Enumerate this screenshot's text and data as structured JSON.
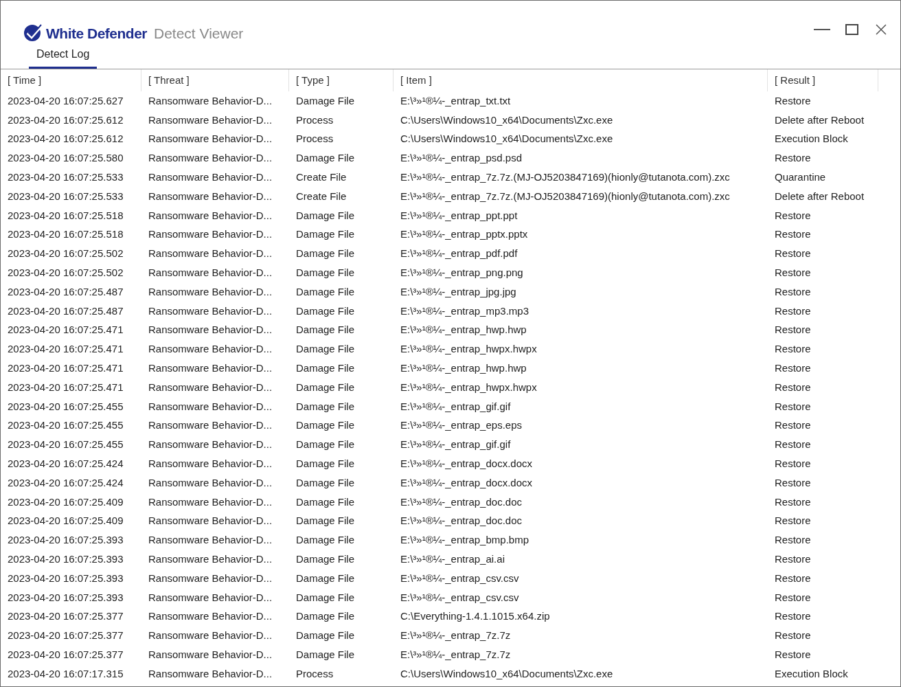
{
  "window": {
    "brand": "White Defender",
    "title": "Detect Viewer"
  },
  "tabs": [
    {
      "label": "Detect Log",
      "selected": true
    }
  ],
  "table": {
    "columns": [
      "[ Time ]",
      "[ Threat ]",
      "[ Type ]",
      "[ Item ]",
      "[ Result ]"
    ],
    "rows": [
      [
        "2023-04-20 16:07:25.627",
        "Ransomware Behavior-D...",
        "Damage File",
        "E:\\³»¹®¼-_entrap_txt.txt",
        "Restore"
      ],
      [
        "2023-04-20 16:07:25.612",
        "Ransomware Behavior-D...",
        "Process",
        "C:\\Users\\Windows10_x64\\Documents\\Zxc.exe",
        "Delete after Reboot"
      ],
      [
        "2023-04-20 16:07:25.612",
        "Ransomware Behavior-D...",
        "Process",
        "C:\\Users\\Windows10_x64\\Documents\\Zxc.exe",
        "Execution Block"
      ],
      [
        "2023-04-20 16:07:25.580",
        "Ransomware Behavior-D...",
        "Damage File",
        "E:\\³»¹®¼-_entrap_psd.psd",
        "Restore"
      ],
      [
        "2023-04-20 16:07:25.533",
        "Ransomware Behavior-D...",
        "Create File",
        "E:\\³»¹®¼-_entrap_7z.7z.(MJ-OJ5203847169)(hionly@tutanota.com).zxc",
        "Quarantine"
      ],
      [
        "2023-04-20 16:07:25.533",
        "Ransomware Behavior-D...",
        "Create File",
        "E:\\³»¹®¼-_entrap_7z.7z.(MJ-OJ5203847169)(hionly@tutanota.com).zxc",
        "Delete after Reboot"
      ],
      [
        "2023-04-20 16:07:25.518",
        "Ransomware Behavior-D...",
        "Damage File",
        "E:\\³»¹®¼-_entrap_ppt.ppt",
        "Restore"
      ],
      [
        "2023-04-20 16:07:25.518",
        "Ransomware Behavior-D...",
        "Damage File",
        "E:\\³»¹®¼-_entrap_pptx.pptx",
        "Restore"
      ],
      [
        "2023-04-20 16:07:25.502",
        "Ransomware Behavior-D...",
        "Damage File",
        "E:\\³»¹®¼-_entrap_pdf.pdf",
        "Restore"
      ],
      [
        "2023-04-20 16:07:25.502",
        "Ransomware Behavior-D...",
        "Damage File",
        "E:\\³»¹®¼-_entrap_png.png",
        "Restore"
      ],
      [
        "2023-04-20 16:07:25.487",
        "Ransomware Behavior-D...",
        "Damage File",
        "E:\\³»¹®¼-_entrap_jpg.jpg",
        "Restore"
      ],
      [
        "2023-04-20 16:07:25.487",
        "Ransomware Behavior-D...",
        "Damage File",
        "E:\\³»¹®¼-_entrap_mp3.mp3",
        "Restore"
      ],
      [
        "2023-04-20 16:07:25.471",
        "Ransomware Behavior-D...",
        "Damage File",
        "E:\\³»¹®¼-_entrap_hwp.hwp",
        "Restore"
      ],
      [
        "2023-04-20 16:07:25.471",
        "Ransomware Behavior-D...",
        "Damage File",
        "E:\\³»¹®¼-_entrap_hwpx.hwpx",
        "Restore"
      ],
      [
        "2023-04-20 16:07:25.471",
        "Ransomware Behavior-D...",
        "Damage File",
        "E:\\³»¹®¼-_entrap_hwp.hwp",
        "Restore"
      ],
      [
        "2023-04-20 16:07:25.471",
        "Ransomware Behavior-D...",
        "Damage File",
        "E:\\³»¹®¼-_entrap_hwpx.hwpx",
        "Restore"
      ],
      [
        "2023-04-20 16:07:25.455",
        "Ransomware Behavior-D...",
        "Damage File",
        "E:\\³»¹®¼-_entrap_gif.gif",
        "Restore"
      ],
      [
        "2023-04-20 16:07:25.455",
        "Ransomware Behavior-D...",
        "Damage File",
        "E:\\³»¹®¼-_entrap_eps.eps",
        "Restore"
      ],
      [
        "2023-04-20 16:07:25.455",
        "Ransomware Behavior-D...",
        "Damage File",
        "E:\\³»¹®¼-_entrap_gif.gif",
        "Restore"
      ],
      [
        "2023-04-20 16:07:25.424",
        "Ransomware Behavior-D...",
        "Damage File",
        "E:\\³»¹®¼-_entrap_docx.docx",
        "Restore"
      ],
      [
        "2023-04-20 16:07:25.424",
        "Ransomware Behavior-D...",
        "Damage File",
        "E:\\³»¹®¼-_entrap_docx.docx",
        "Restore"
      ],
      [
        "2023-04-20 16:07:25.409",
        "Ransomware Behavior-D...",
        "Damage File",
        "E:\\³»¹®¼-_entrap_doc.doc",
        "Restore"
      ],
      [
        "2023-04-20 16:07:25.409",
        "Ransomware Behavior-D...",
        "Damage File",
        "E:\\³»¹®¼-_entrap_doc.doc",
        "Restore"
      ],
      [
        "2023-04-20 16:07:25.393",
        "Ransomware Behavior-D...",
        "Damage File",
        "E:\\³»¹®¼-_entrap_bmp.bmp",
        "Restore"
      ],
      [
        "2023-04-20 16:07:25.393",
        "Ransomware Behavior-D...",
        "Damage File",
        "E:\\³»¹®¼-_entrap_ai.ai",
        "Restore"
      ],
      [
        "2023-04-20 16:07:25.393",
        "Ransomware Behavior-D...",
        "Damage File",
        "E:\\³»¹®¼-_entrap_csv.csv",
        "Restore"
      ],
      [
        "2023-04-20 16:07:25.393",
        "Ransomware Behavior-D...",
        "Damage File",
        "E:\\³»¹®¼-_entrap_csv.csv",
        "Restore"
      ],
      [
        "2023-04-20 16:07:25.377",
        "Ransomware Behavior-D...",
        "Damage File",
        "C:\\Everything-1.4.1.1015.x64.zip",
        "Restore"
      ],
      [
        "2023-04-20 16:07:25.377",
        "Ransomware Behavior-D...",
        "Damage File",
        "E:\\³»¹®¼-_entrap_7z.7z",
        "Restore"
      ],
      [
        "2023-04-20 16:07:25.377",
        "Ransomware Behavior-D...",
        "Damage File",
        "E:\\³»¹®¼-_entrap_7z.7z",
        "Restore"
      ],
      [
        "2023-04-20 16:07:17.315",
        "Ransomware Behavior-D...",
        "Process",
        "C:\\Users\\Windows10_x64\\Documents\\Zxc.exe",
        "Execution Block"
      ]
    ]
  }
}
